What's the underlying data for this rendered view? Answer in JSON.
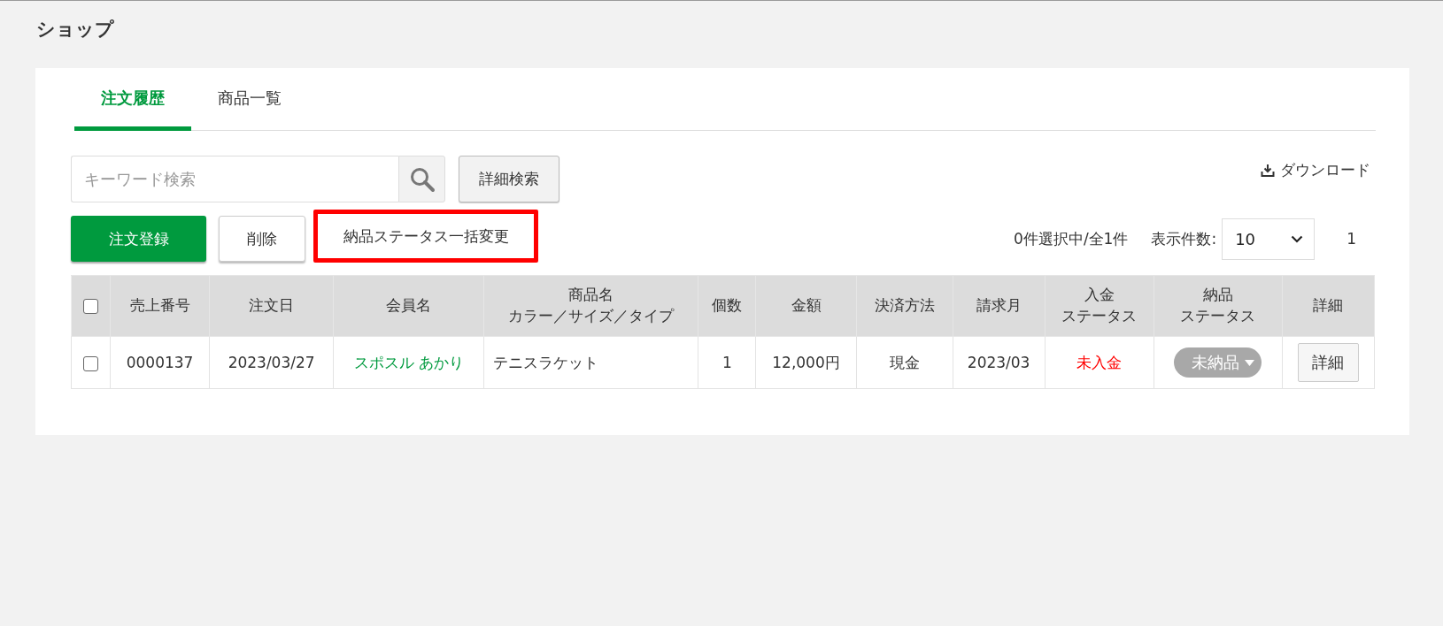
{
  "page_title": "ショップ",
  "tabs": [
    {
      "label": "注文履歴",
      "selected": true
    },
    {
      "label": "商品一覧",
      "selected": false
    }
  ],
  "search": {
    "placeholder": "キーワード検索"
  },
  "advanced_search_button": "詳細検索",
  "download_link": "ダウンロード",
  "actions": [
    {
      "label": "注文登録",
      "kind": "primary"
    },
    {
      "label": "削除",
      "kind": "secondary"
    },
    {
      "label": "納品ステータス一括変更",
      "kind": "highlighted"
    }
  ],
  "selection_count": "0件選択中/全1件",
  "page_size": {
    "label": "表示件数:",
    "value": "10"
  },
  "pagination": [
    {
      "label": "1",
      "selected": true
    }
  ],
  "table": {
    "header_checkbox": {
      "checked": false
    },
    "columns": [
      {
        "label": "売上番号"
      },
      {
        "label": "注文日"
      },
      {
        "label": "会員名"
      },
      {
        "label": "商品名",
        "subtitle": "カラー／サイズ／タイプ"
      },
      {
        "label": "個数"
      },
      {
        "label": "金額"
      },
      {
        "label": "決済方法"
      },
      {
        "label": "請求月"
      },
      {
        "label": "入金",
        "subtitle": "ステータス"
      },
      {
        "label": "納品",
        "subtitle": "ステータス"
      },
      {
        "label": "詳細"
      }
    ],
    "rows": [
      {
        "checked": false,
        "cells": [
          {
            "kind": "text",
            "text": "0000137"
          },
          {
            "kind": "text",
            "text": "2023/03/27"
          },
          {
            "kind": "link",
            "text": "スポスル あかり"
          },
          {
            "kind": "left",
            "text": "テニスラケット"
          },
          {
            "kind": "text",
            "text": "1"
          },
          {
            "kind": "text",
            "text": "12,000円"
          },
          {
            "kind": "text",
            "text": "現金"
          },
          {
            "kind": "text",
            "text": "2023/03"
          },
          {
            "kind": "alert",
            "text": "未入金"
          },
          {
            "kind": "dropdown",
            "text": "未納品"
          },
          {
            "kind": "button",
            "text": "詳細"
          }
        ]
      }
    ]
  }
}
